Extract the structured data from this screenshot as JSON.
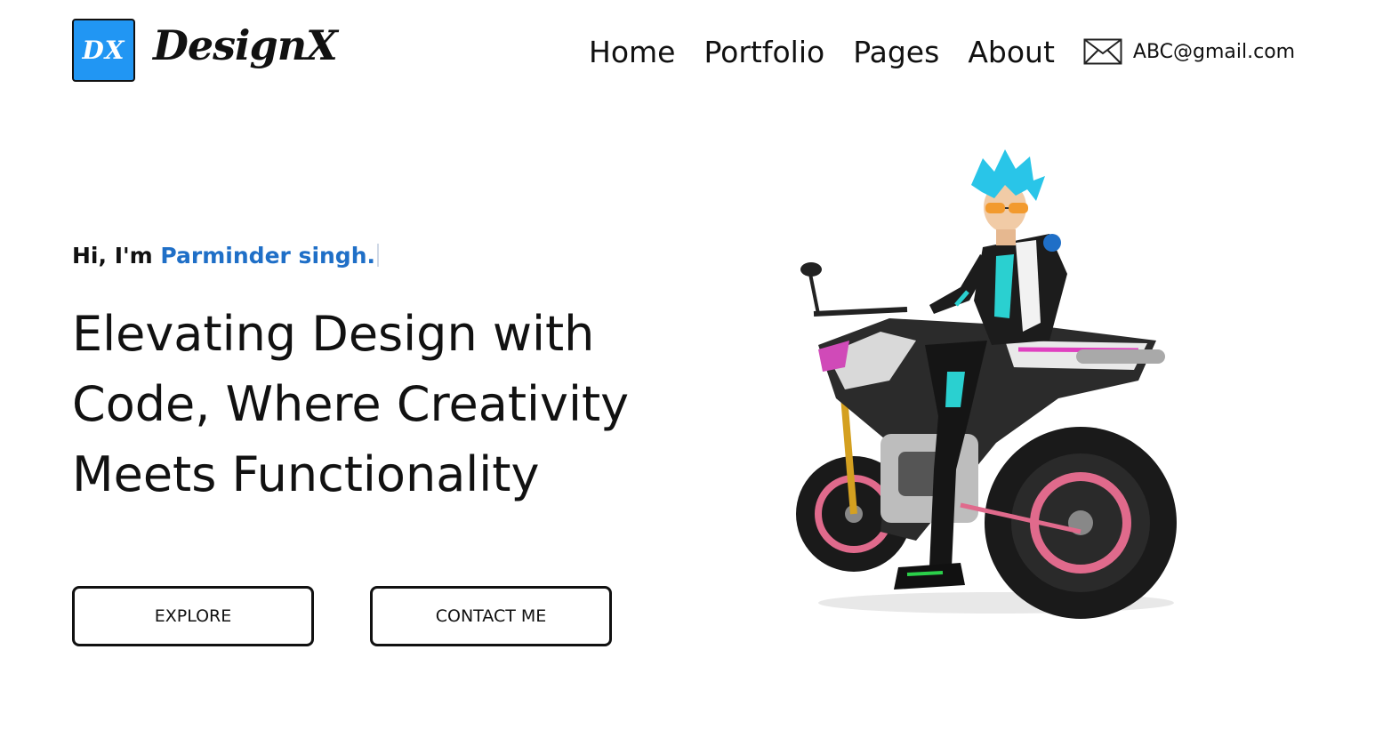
{
  "header": {
    "logo_text": "DX",
    "brand_name": "DesignX",
    "nav": [
      {
        "label": "Home"
      },
      {
        "label": "Portfolio"
      },
      {
        "label": "Pages"
      },
      {
        "label": "About"
      }
    ],
    "email_icon": "envelope-icon",
    "email": "ABC@gmail.com"
  },
  "hero": {
    "greeting_prefix": "Hi, I'm ",
    "greeting_name": "Parminder singh.",
    "headline_lines": [
      "Elevating Design with",
      "Code, Where Creativity",
      "Meets Functionality"
    ],
    "buttons": {
      "explore": "EXPLORE",
      "contact": "CONTACT ME"
    },
    "illustration": "anime-rider-on-motorcycle"
  },
  "colors": {
    "logo_bg": "#2196f3",
    "name_accent": "#1f6fc7",
    "text": "#111111",
    "background": "#ffffff"
  }
}
